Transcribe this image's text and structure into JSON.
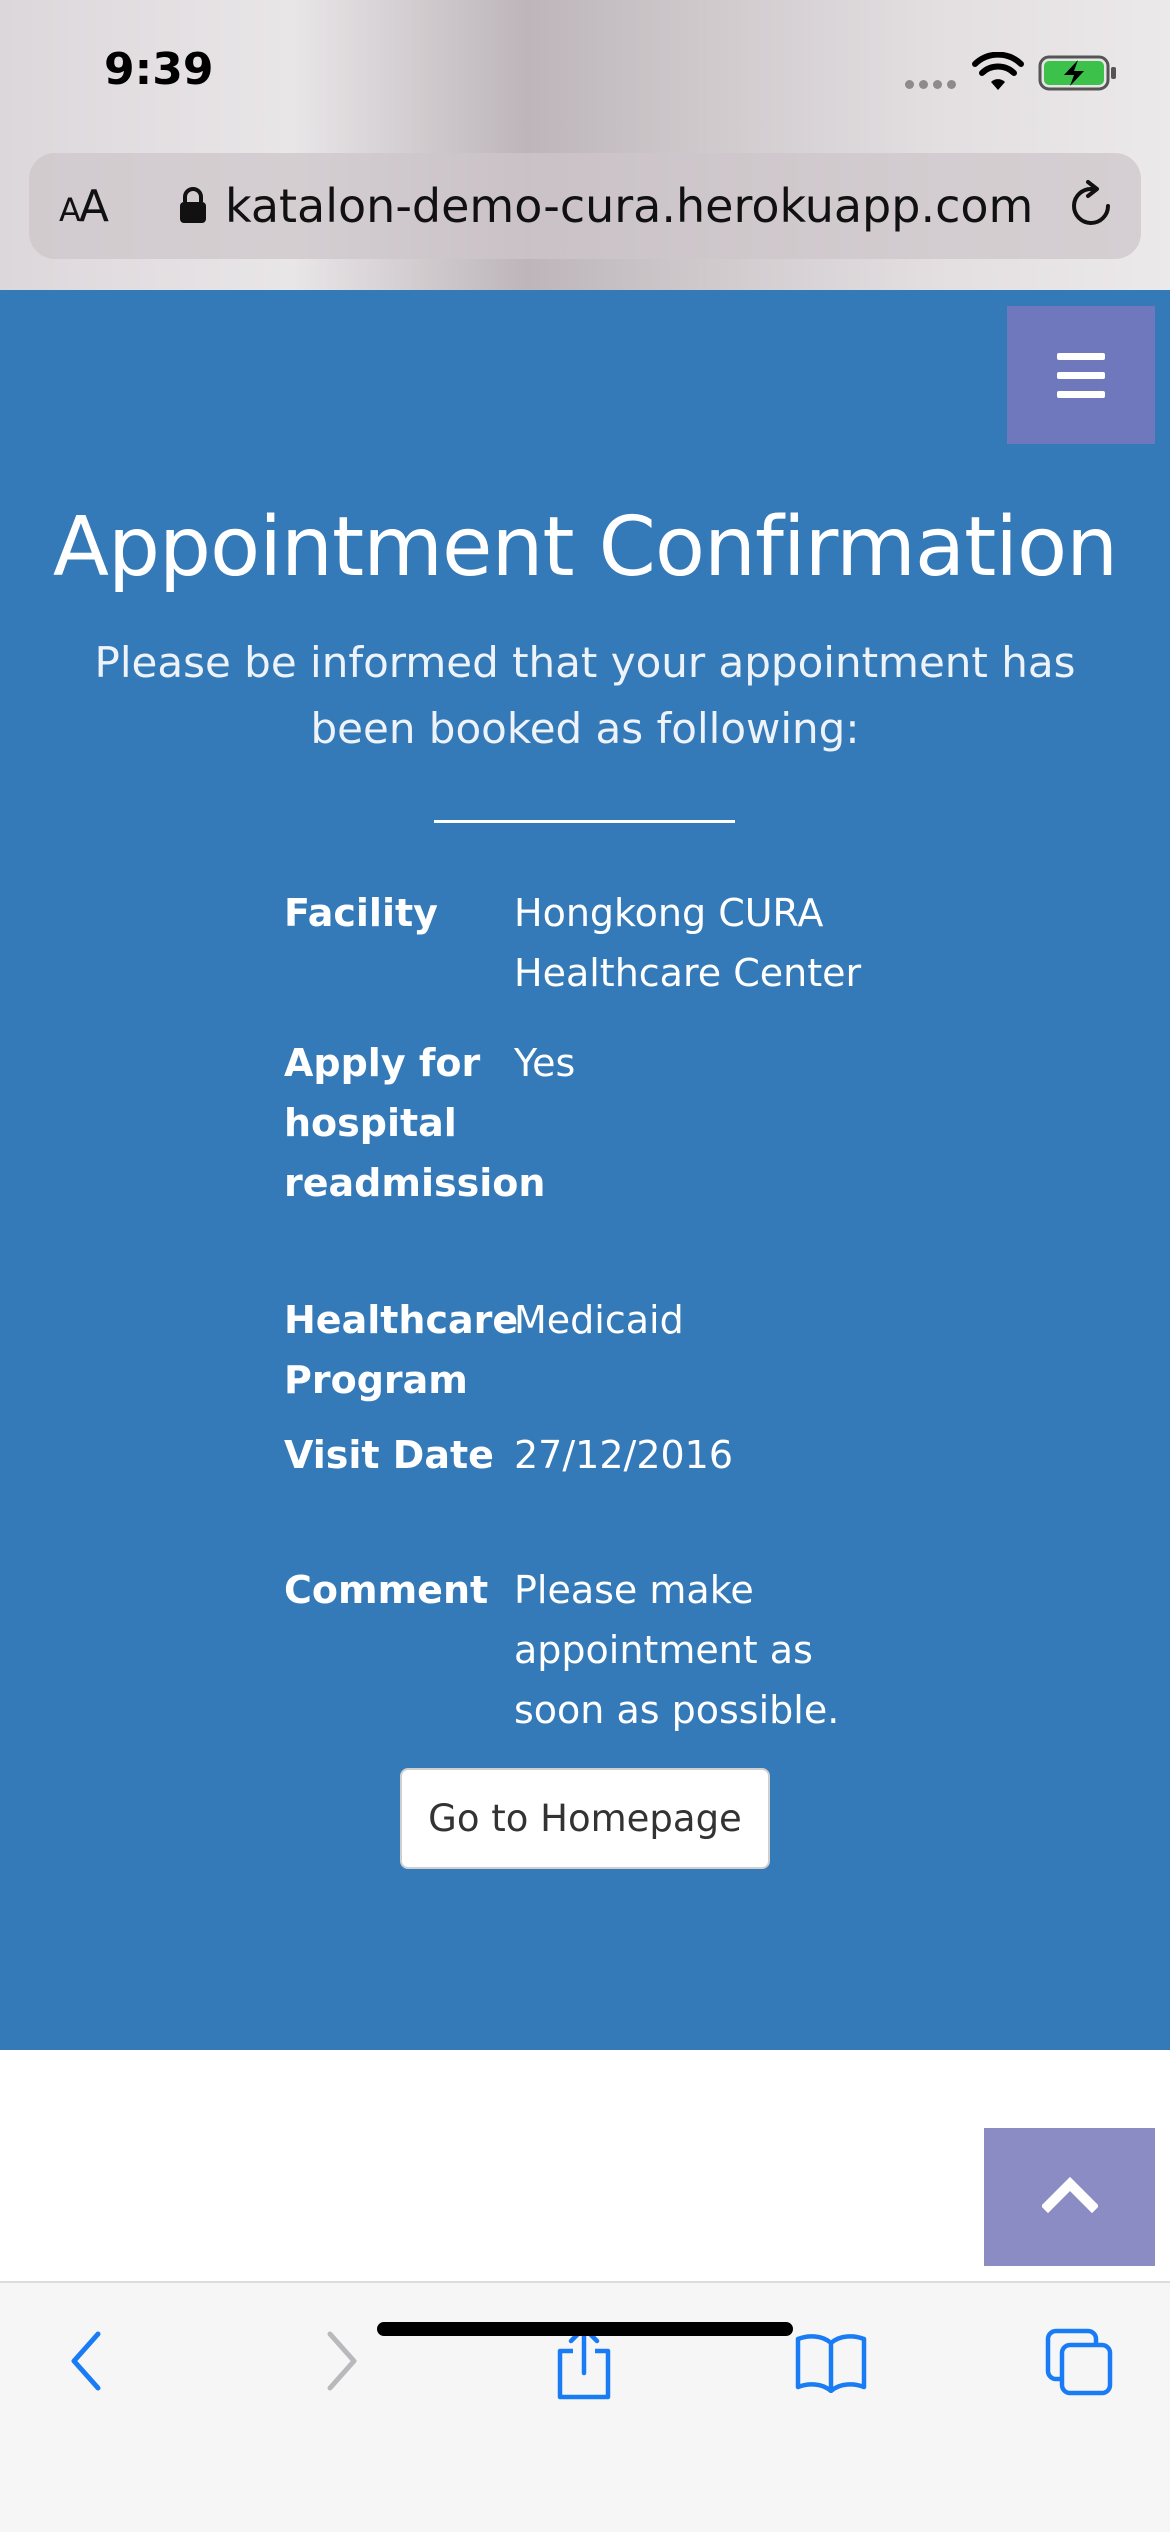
{
  "status_bar": {
    "time": "9:39"
  },
  "browser": {
    "aa_small": "A",
    "aa_large": "A",
    "url": "katalon-demo-cura.herokuapp.com"
  },
  "page": {
    "title": "Appointment Confirmation",
    "subtitle": "Please be informed that your appointment has been booked as following:",
    "details": [
      {
        "label": "Facility",
        "value": "Hongkong CURA Healthcare Center"
      },
      {
        "label": "Apply for hospital readmission",
        "value": "Yes"
      },
      {
        "label": "Healthcare Program",
        "value": "Medicaid"
      },
      {
        "label": "Visit Date",
        "value": "27/12/2016"
      },
      {
        "label": "Comment",
        "value": "Please make appointment as soon as possible."
      }
    ],
    "home_button_label": "Go to Homepage"
  },
  "icons": {
    "menu": "hamburger-menu-icon",
    "scroll_top": "chevron-up-icon",
    "toolbar": [
      "back-icon",
      "forward-icon",
      "share-icon",
      "bookmarks-icon",
      "tabs-icon"
    ]
  },
  "colors": {
    "hero_background": "#357ab8",
    "menu_button": "#6f78bd",
    "scroll_top_button": "#8b8cc4",
    "toolbar_accent": "#1a7cf5"
  }
}
